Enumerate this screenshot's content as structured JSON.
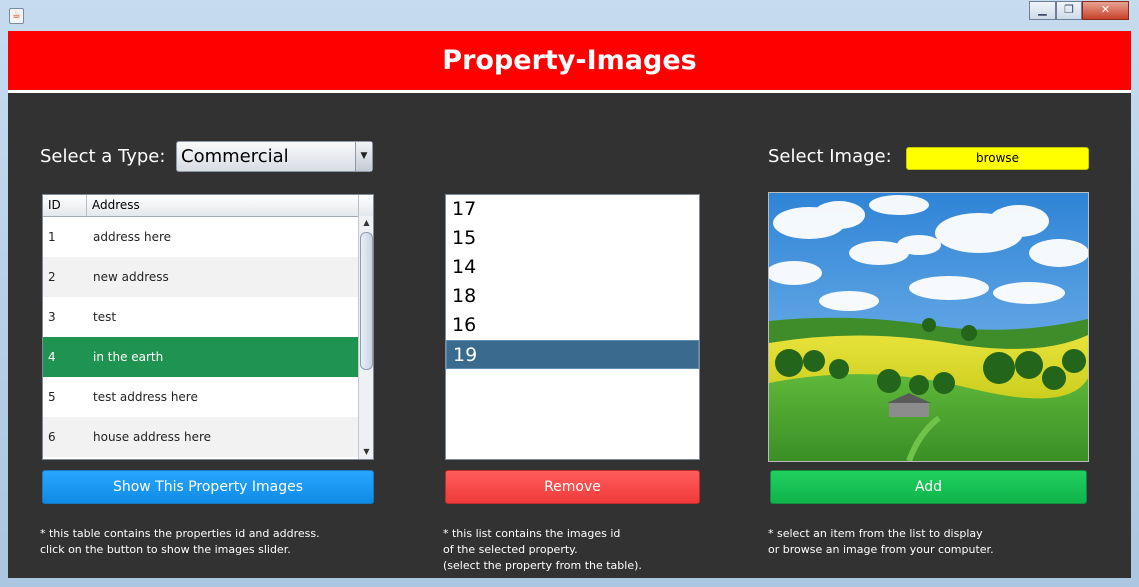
{
  "window": {
    "controls": [
      "minimize",
      "restore",
      "close"
    ]
  },
  "header": {
    "title": "Property-Images",
    "bg_color": "#ff0000"
  },
  "select_type": {
    "label": "Select a Type:",
    "value": "Commercial"
  },
  "select_image": {
    "label": "Select Image:",
    "browse_label": "browse",
    "browse_color": "#ffff00"
  },
  "table": {
    "columns": [
      "ID",
      "Address"
    ],
    "rows": [
      {
        "id": "1",
        "address": "address here"
      },
      {
        "id": "2",
        "address": "new address"
      },
      {
        "id": "3",
        "address": "test"
      },
      {
        "id": "4",
        "address": "in the earth"
      },
      {
        "id": "5",
        "address": "test address here"
      },
      {
        "id": "6",
        "address": "house address here"
      }
    ],
    "selected_color": "#1e9450"
  },
  "image_ids": {
    "items": [
      "17",
      "15",
      "14",
      "18",
      "16",
      "19"
    ],
    "selected_color": "#3a6a8e"
  },
  "buttons": {
    "show": "Show This Property Images",
    "remove": "Remove",
    "add": "Add"
  },
  "notes": {
    "table": "* this table contains the properties id and address.\nclick on the button to show the images slider.",
    "list": "* this list contains the images id\nof the selected property.\n(select the property from the table).",
    "image": "* select an item from the list to display\nor browse an image from your computer."
  }
}
